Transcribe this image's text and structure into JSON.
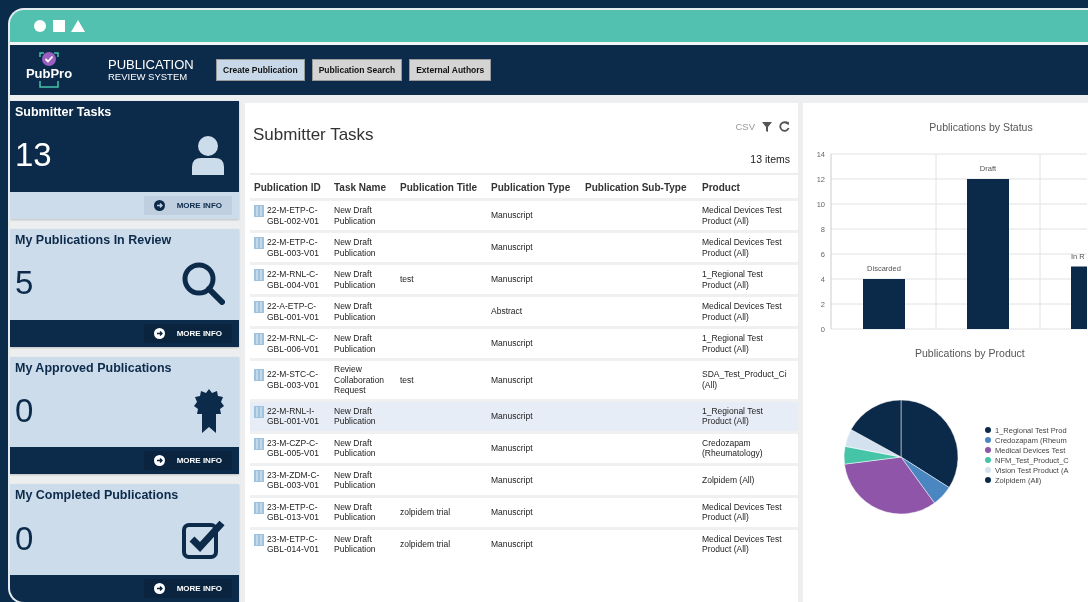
{
  "app": {
    "logo": "PubPro",
    "title": "PUBLICATION",
    "subtitle": "REVIEW SYSTEM"
  },
  "nav": [
    {
      "label": "Create Publication",
      "selected": true
    },
    {
      "label": "Publication Search",
      "selected": false
    },
    {
      "label": "External Authors",
      "selected": false
    }
  ],
  "cards": [
    {
      "title": "Submitter Tasks",
      "count": "13",
      "selected": true,
      "link": "MORE INFO"
    },
    {
      "title": "My Publications In Review",
      "count": "5",
      "selected": false,
      "link": "MORE INFO"
    },
    {
      "title": "My Approved Publications",
      "count": "0",
      "selected": false,
      "link": "MORE INFO"
    },
    {
      "title": "My Completed Publications",
      "count": "0",
      "selected": false,
      "link": "MORE INFO"
    }
  ],
  "tasks": {
    "title": "Submitter Tasks",
    "csv": "CSV",
    "count": "13 items",
    "columns": [
      "Publication ID",
      "Task Name",
      "Publication Title",
      "Publication Type",
      "Publication Sub-Type",
      "Product"
    ],
    "rows": [
      {
        "id": "22-M-ETP-C-GBL-002-V01",
        "task": "New Draft Publication",
        "title": "",
        "type": "Manuscript",
        "product": "Medical Devices Test Product (All)",
        "selected": false
      },
      {
        "id": "22-M-ETP-C-GBL-003-V01",
        "task": "New Draft Publication",
        "title": "",
        "type": "Manuscript",
        "product": "Medical Devices Test Product (All)",
        "selected": false
      },
      {
        "id": "22-M-RNL-C-GBL-004-V01",
        "task": "New Draft Publication",
        "title": "test",
        "type": "Manuscript",
        "product": "1_Regional Test Product (All)",
        "selected": false
      },
      {
        "id": "22-A-ETP-C-GBL-001-V01",
        "task": "New Draft Publication",
        "title": "",
        "type": "Abstract",
        "product": "Medical Devices Test Product (All)",
        "selected": false
      },
      {
        "id": "22-M-RNL-C-GBL-006-V01",
        "task": "New Draft Publication",
        "title": "",
        "type": "Manuscript",
        "product": "1_Regional Test Product (All)",
        "selected": false
      },
      {
        "id": "22-M-STC-C-GBL-003-V01",
        "task": "Review Collaboration Request",
        "title": "test",
        "type": "Manuscript",
        "product": "SDA_Test_Product_Ci (All)",
        "selected": false
      },
      {
        "id": "22-M-RNL-I-GBL-001-V01",
        "task": "New Draft Publication",
        "title": "",
        "type": "Manuscript",
        "product": "1_Regional Test Product (All)",
        "selected": true
      },
      {
        "id": "23-M-CZP-C-GBL-005-V01",
        "task": "New Draft Publication",
        "title": "",
        "type": "Manuscript",
        "product": "Credozapam (Rheumatology)",
        "selected": false
      },
      {
        "id": "23-M-ZDM-C-GBL-003-V01",
        "task": "New Draft Publication",
        "title": "",
        "type": "Manuscript",
        "product": "Zolpidem (All)",
        "selected": false
      },
      {
        "id": "23-M-ETP-C-GBL-013-V01",
        "task": "New Draft Publication",
        "title": "zolpidem trial",
        "type": "Manuscript",
        "product": "Medical Devices Test Product (All)",
        "selected": false
      },
      {
        "id": "23-M-ETP-C-GBL-014-V01",
        "task": "New Draft Publication",
        "title": "zolpidem trial",
        "type": "Manuscript",
        "product": "Medical Devices Test Product (All)",
        "selected": false
      }
    ]
  },
  "status_chart": {
    "chart_data": {
      "type": "bar",
      "grid": true,
      "title": "Publications by Status",
      "categories": [
        "Discarded",
        "Draft",
        "In R"
      ],
      "values": [
        4,
        12,
        5
      ],
      "ylim": [
        0,
        14
      ],
      "yticks": [
        0,
        2,
        4,
        6,
        8,
        10,
        12,
        14
      ]
    }
  },
  "product_chart": {
    "title": "Publications by Product",
    "legend": [
      {
        "label": "1_Regional Test Prod",
        "color": "#0b2a4a"
      },
      {
        "label": "Credozapam (Rheum",
        "color": "#4a86c0"
      },
      {
        "label": "Medical Devices Test",
        "color": "#8e55a8"
      },
      {
        "label": "NFM_Test_Product_C",
        "color": "#45c4a8"
      },
      {
        "label": "Vision Test Product (A",
        "color": "#d4e2ef"
      },
      {
        "label": "Zolpidem (All)",
        "color": "#0b2a4a"
      }
    ]
  }
}
